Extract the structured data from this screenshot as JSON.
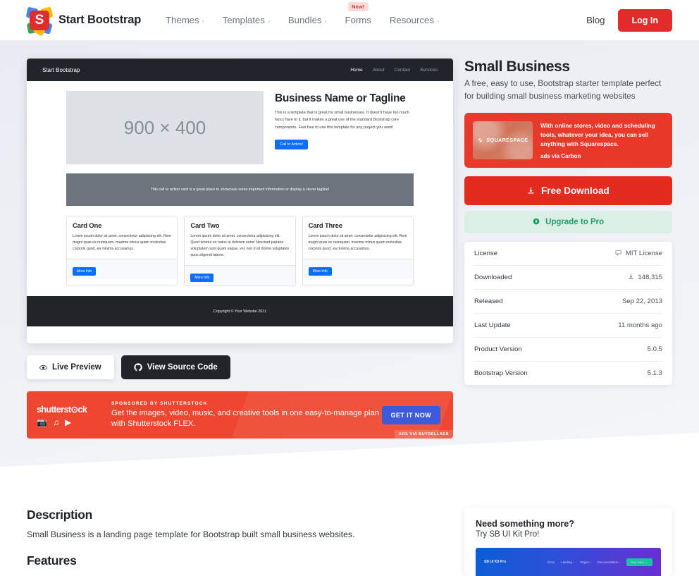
{
  "navbar": {
    "brand": "Start Bootstrap",
    "logo_letter": "S",
    "items": [
      {
        "label": "Themes",
        "chevron": "›",
        "badge": ""
      },
      {
        "label": "Templates",
        "chevron": "›",
        "badge": ""
      },
      {
        "label": "Bundles",
        "chevron": "›",
        "badge": ""
      },
      {
        "label": "Forms",
        "chevron": "",
        "badge": "New!"
      },
      {
        "label": "Resources",
        "chevron": "›",
        "badge": ""
      }
    ],
    "blog": "Blog",
    "login": "Log In",
    "login_color": "#e32b2b"
  },
  "template": {
    "title": "Small Business",
    "subtitle": "A free, easy to use, Bootstrap starter template perfect for building small business marketing websites"
  },
  "carbon_ad": {
    "image_label": "SQUARESPACE",
    "text": "With online stores, video and scheduling tools, whatever your idea, you can sell anything with Squarespace.",
    "by": "ads via Carbon",
    "bg_color": "#e8392b"
  },
  "actions": {
    "download": "Free Download",
    "download_icon": "download-icon",
    "upgrade": "Upgrade to Pro",
    "upgrade_icon": "arrow-up-circle-icon",
    "download_color": "#e32b1e",
    "upgrade_color": "#1b9e63"
  },
  "info": {
    "rows": [
      {
        "label": "License",
        "value": "MIT License",
        "icon": "certificate-icon"
      },
      {
        "label": "Downloaded",
        "value": "148,315",
        "icon": "download-icon"
      },
      {
        "label": "Released",
        "value": "Sep 22, 2013",
        "icon": ""
      },
      {
        "label": "Last Update",
        "value": "11 months ago",
        "icon": ""
      },
      {
        "label": "Product Version",
        "value": "5.0.5",
        "icon": ""
      },
      {
        "label": "Bootstrap Version",
        "value": "5.1.3",
        "icon": ""
      }
    ]
  },
  "preview": {
    "navbar_brand": "Start Bootstrap",
    "navbar_links": [
      "Home",
      "About",
      "Contact",
      "Services"
    ],
    "placeholder": "900 × 400",
    "heading": "Business Name or Tagline",
    "paragraph": "This is a template that is great for small businesses. It doesn't have too much fancy flare to it, but it makes a great use of the standard Bootstrap core components. Feel free to use this template for any project you want!",
    "cta_button": "Call to Action!",
    "callout": "This call to action card is a great place to showcase some important information or display a clever tagline!",
    "cards": [
      {
        "title": "Card One",
        "text": "Lorem ipsum dolor sit amet, consectetur adipisicing elit. Rem magni quas ex numquam, maxime minus quam molestias corporis quod, ea minima accusamus.",
        "button": "More Info"
      },
      {
        "title": "Card Two",
        "text": "Lorem ipsum dolor sit amet, consectetur adipisicing elit. Quod tenetur ex natus at dolorem enim! Nesciunt pariatur voluptatem sunt quam eaque, vel, non in id dolore voluptates quos eligendi labore.",
        "button": "More Info"
      },
      {
        "title": "Card Three",
        "text": "Lorem ipsum dolor sit amet, consectetur adipisicing elit. Rem magni quas ex numquam, maxime minus quam molestias corporis quod, ea minima accusamus.",
        "button": "More Info"
      }
    ],
    "footer": "Copyright © Your Website 2021"
  },
  "preview_actions": {
    "live_preview": "Live Preview",
    "live_preview_icon": "eye-icon",
    "view_source": "View Source Code",
    "view_source_icon": "github-icon"
  },
  "shutterstock": {
    "wordmark": "shutterst⊙ck",
    "kicker": "SPONSORED BY SHUTTERSTOCK",
    "headline": "Get the images, video, music, and creative tools in one easy-to-manage plan with Shutterstock FLEX.",
    "cta": "GET IT NOW",
    "credit": "ADS VIA BUYSELLADS",
    "bg_color": "#ee4630",
    "cta_color": "#3b5bdb"
  },
  "description": {
    "heading": "Description",
    "body": "Small Business is a landing page template for Bootstrap built small business websites.",
    "features_heading": "Features"
  },
  "promo": {
    "heading": "Need something more?",
    "subheading": "Try SB UI Kit Pro!",
    "shot_brand": "SB UI Kit Pro",
    "shot_links": [
      "Docs",
      "Landing ›",
      "Pages ›",
      "Documentation ›"
    ],
    "shot_button": "Buy Now →"
  }
}
